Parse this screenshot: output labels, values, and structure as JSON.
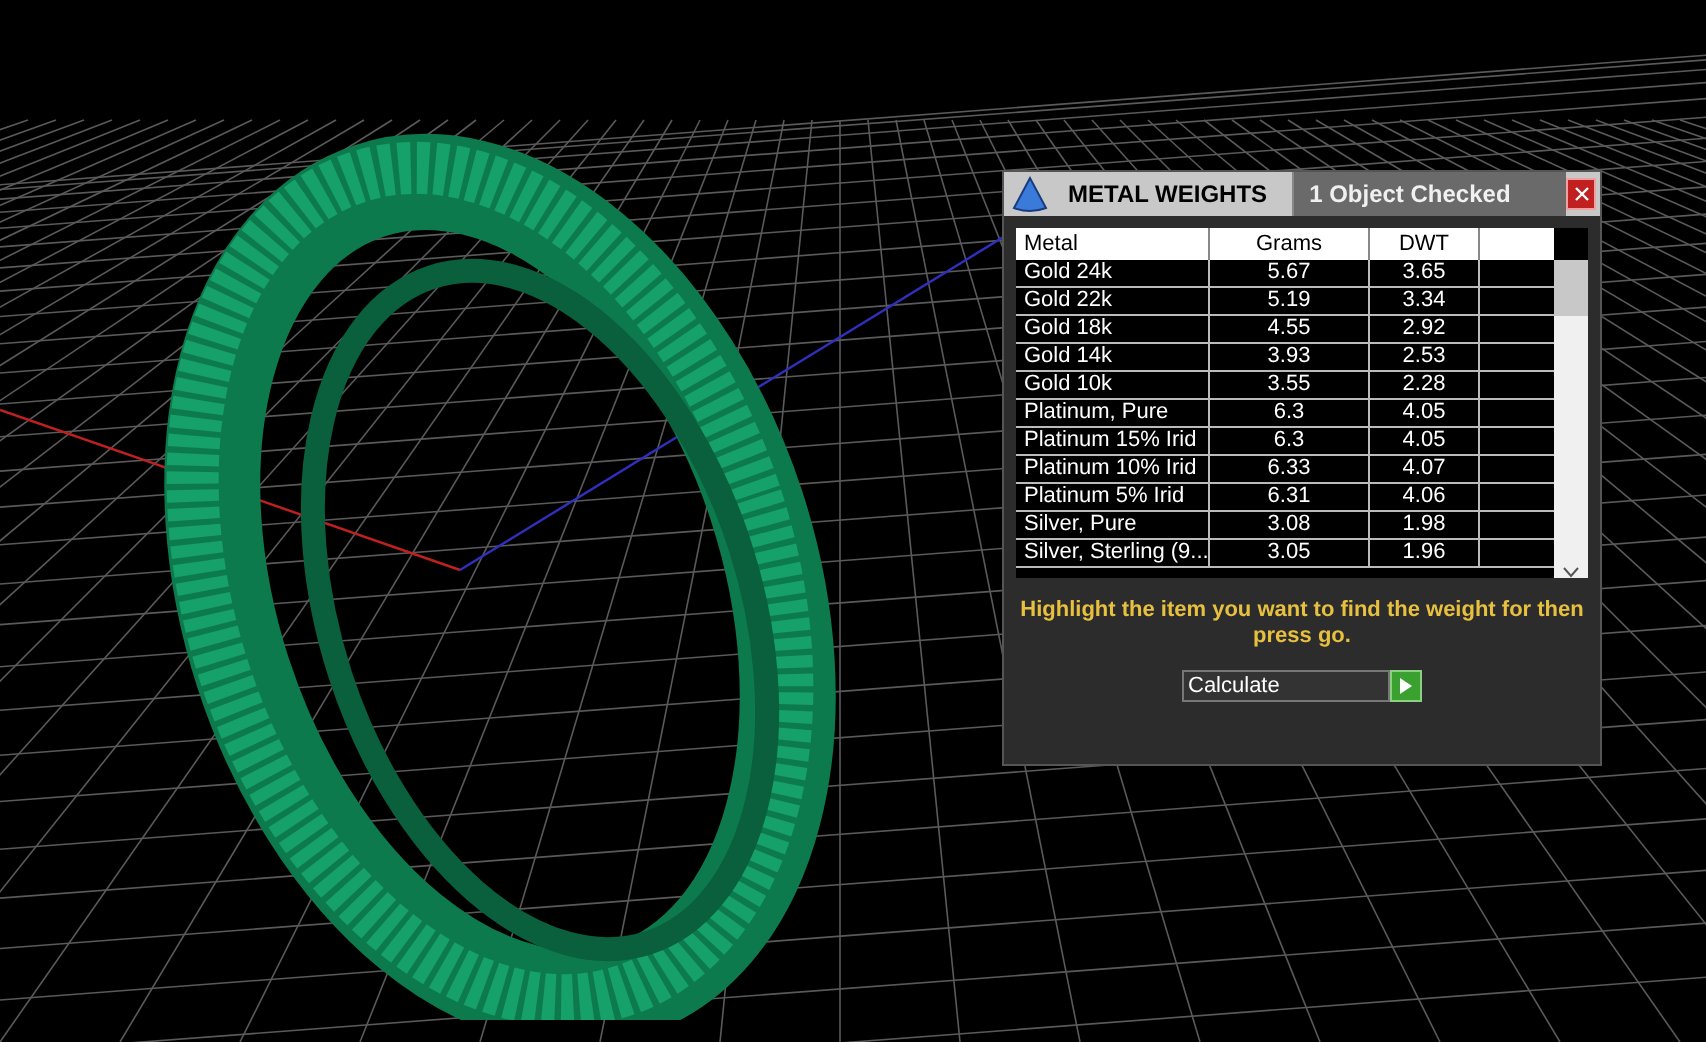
{
  "dialog": {
    "title": "METAL WEIGHTS",
    "status": "1 Object Checked"
  },
  "table": {
    "columns": [
      "Metal",
      "Grams",
      "DWT"
    ],
    "rows": [
      {
        "metal": "Gold 24k",
        "grams": "5.67",
        "dwt": "3.65"
      },
      {
        "metal": "Gold 22k",
        "grams": "5.19",
        "dwt": "3.34"
      },
      {
        "metal": "Gold 18k",
        "grams": "4.55",
        "dwt": "2.92"
      },
      {
        "metal": "Gold 14k",
        "grams": "3.93",
        "dwt": "2.53"
      },
      {
        "metal": "Gold 10k",
        "grams": "3.55",
        "dwt": "2.28"
      },
      {
        "metal": "Platinum, Pure",
        "grams": "6.3",
        "dwt": "4.05"
      },
      {
        "metal": "Platinum 15% Irid",
        "grams": "6.3",
        "dwt": "4.05"
      },
      {
        "metal": "Platinum 10% Irid",
        "grams": "6.33",
        "dwt": "4.07"
      },
      {
        "metal": "Platinum 5% Irid",
        "grams": "6.31",
        "dwt": "4.06"
      },
      {
        "metal": "Silver, Pure",
        "grams": "3.08",
        "dwt": "1.98"
      },
      {
        "metal": "Silver, Sterling (9...",
        "grams": "3.05",
        "dwt": "1.96"
      }
    ]
  },
  "instruction": "Highlight the item you want to find the weight for then press go.",
  "action": {
    "value": "Calculate"
  }
}
